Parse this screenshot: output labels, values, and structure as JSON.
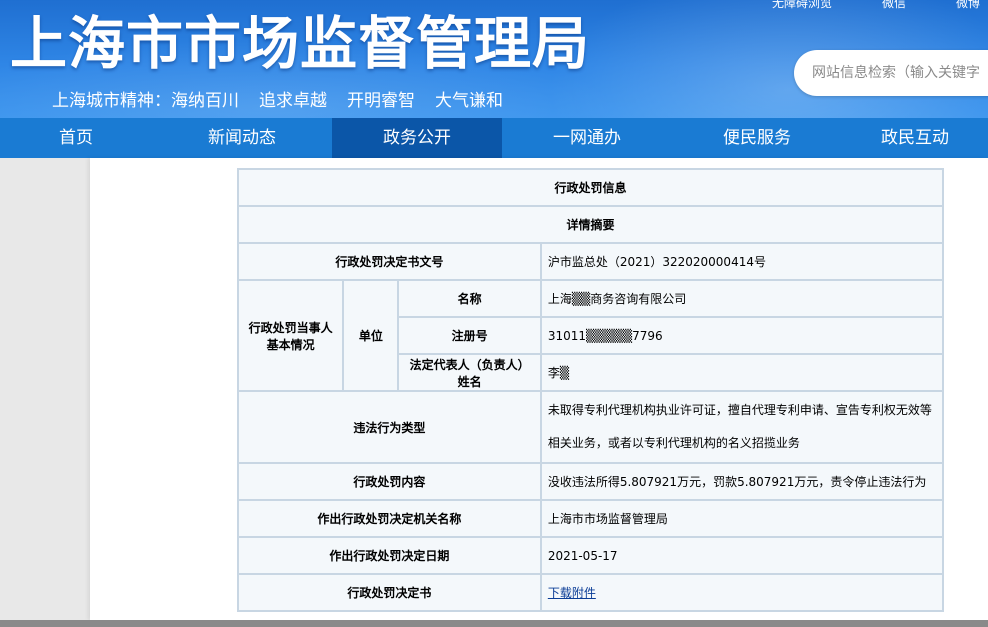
{
  "header": {
    "top_links": [
      "无障碍浏览",
      "微信",
      "微博"
    ],
    "site_title": "上海市市场监督管理局",
    "slogan_prefix": "上海城市精神：",
    "slogan_items": [
      "海纳百川",
      "追求卓越",
      "开明睿智",
      "大气谦和"
    ],
    "search_placeholder": "网站信息检索（输入关键字"
  },
  "nav": {
    "items": [
      "首页",
      "新闻动态",
      "政务公开",
      "一网通办",
      "便民服务",
      "政民互动"
    ],
    "active": "政务公开"
  },
  "table": {
    "title": "行政处罚信息",
    "subtitle": "详情摘要",
    "doc_no_label": "行政处罚决定书文号",
    "doc_no_value": "沪市监总处（2021）322020000414号",
    "party_label": "行政处罚当事人基本情况",
    "unit_label": "单位",
    "name_label": "名称",
    "name_value": "上海▒▒商务咨询有限公司",
    "reg_label": "注册号",
    "reg_value": "31011▒▒▒▒▒7796",
    "rep_label": "法定代表人（负责人）姓名",
    "rep_value": "李▒",
    "violation_label": "违法行为类型",
    "violation_value": "未取得专利代理机构执业许可证，擅自代理专利申请、宣告专利权无效等相关业务，或者以专利代理机构的名义招揽业务",
    "penalty_label": "行政处罚内容",
    "penalty_value": "没收违法所得5.807921万元，罚款5.807921万元，责令停止违法行为",
    "authority_label": "作出行政处罚决定机关名称",
    "authority_value": "上海市市场监督管理局",
    "date_label": "作出行政处罚决定日期",
    "date_value": "2021-05-17",
    "decision_label": "行政处罚决定书",
    "decision_link": "下载附件"
  }
}
